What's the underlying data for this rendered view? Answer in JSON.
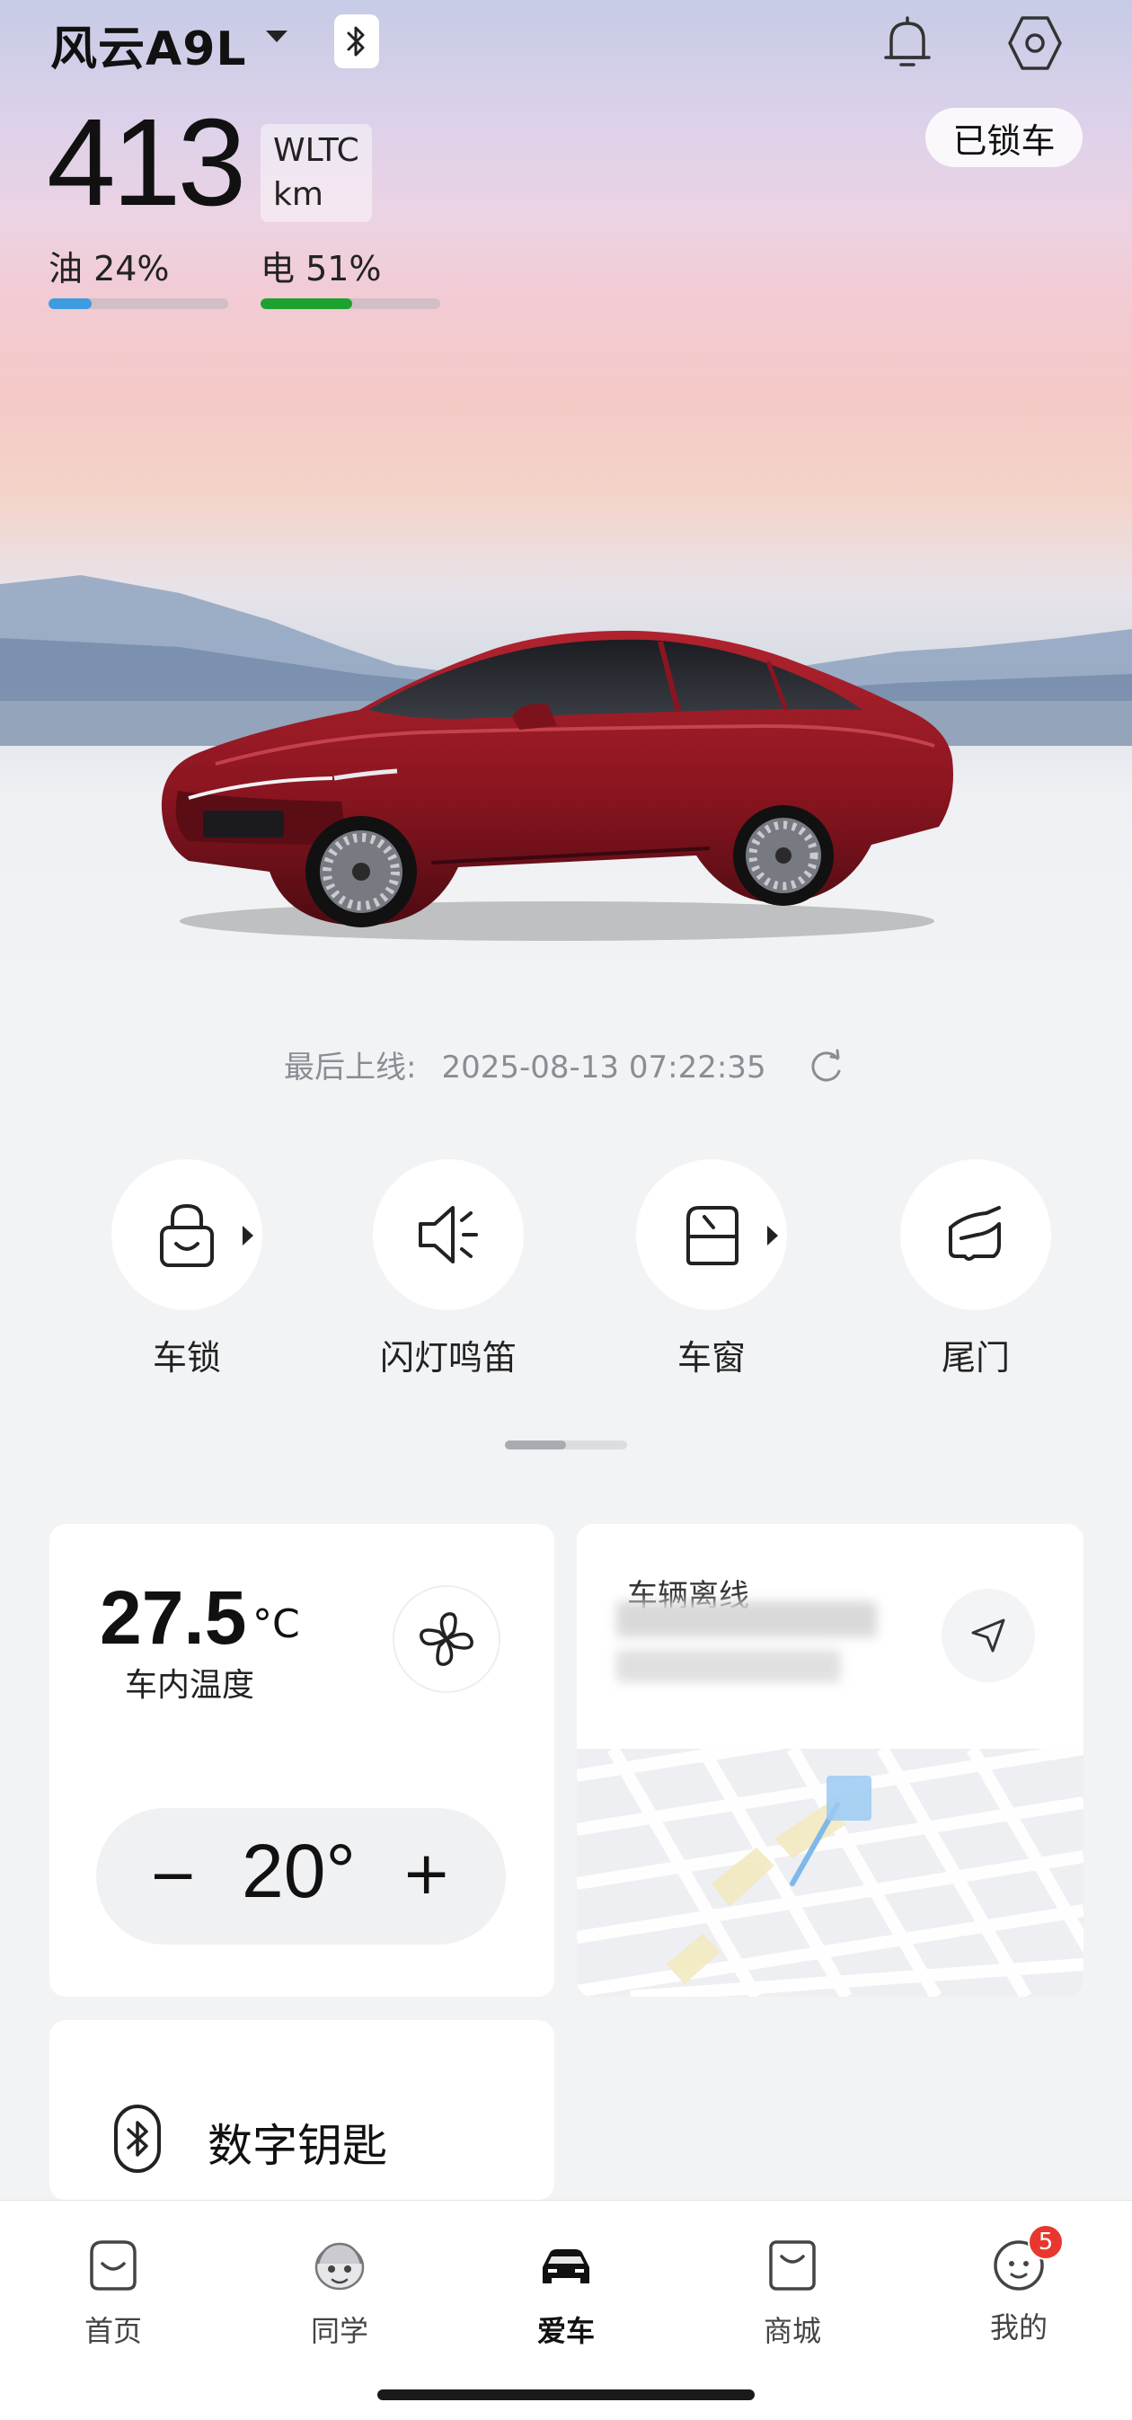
{
  "header": {
    "car_name": "风云A9L",
    "range_value": "413",
    "range_standard": "WLTC",
    "range_unit": "km",
    "lock_status": "已锁车"
  },
  "energy": {
    "fuel_label": "油 24%",
    "fuel_percent": 24,
    "electric_label": "电 51%",
    "electric_percent": 51,
    "fuel_color": "#3d9ce0",
    "electric_color": "#1ea22f"
  },
  "status": {
    "last_online_label": "最后上线:",
    "last_online_time": "2025-08-13 07:22:35"
  },
  "quick_actions": [
    {
      "label": "车锁",
      "icon": "lock-icon"
    },
    {
      "label": "闪灯鸣笛",
      "icon": "horn-light-icon"
    },
    {
      "label": "车窗",
      "icon": "window-icon"
    },
    {
      "label": "尾门",
      "icon": "tailgate-icon"
    }
  ],
  "climate": {
    "cabin_temp": "27.5",
    "temp_unit": "°C",
    "cabin_temp_label": "车内温度",
    "setpoint": "20°",
    "minus": "−",
    "plus": "+"
  },
  "location": {
    "title": "车辆离线"
  },
  "digital_key": {
    "label": "数字钥匙"
  },
  "tabs": [
    {
      "label": "首页",
      "icon": "home-icon"
    },
    {
      "label": "同学",
      "icon": "community-icon"
    },
    {
      "label": "爱车",
      "icon": "car-icon"
    },
    {
      "label": "商城",
      "icon": "shop-icon"
    },
    {
      "label": "我的",
      "icon": "profile-icon",
      "badge": "5"
    }
  ],
  "active_tab": "爱车",
  "accent_colors": {
    "badge": "#e8372f",
    "car_body": "#8a1520"
  }
}
